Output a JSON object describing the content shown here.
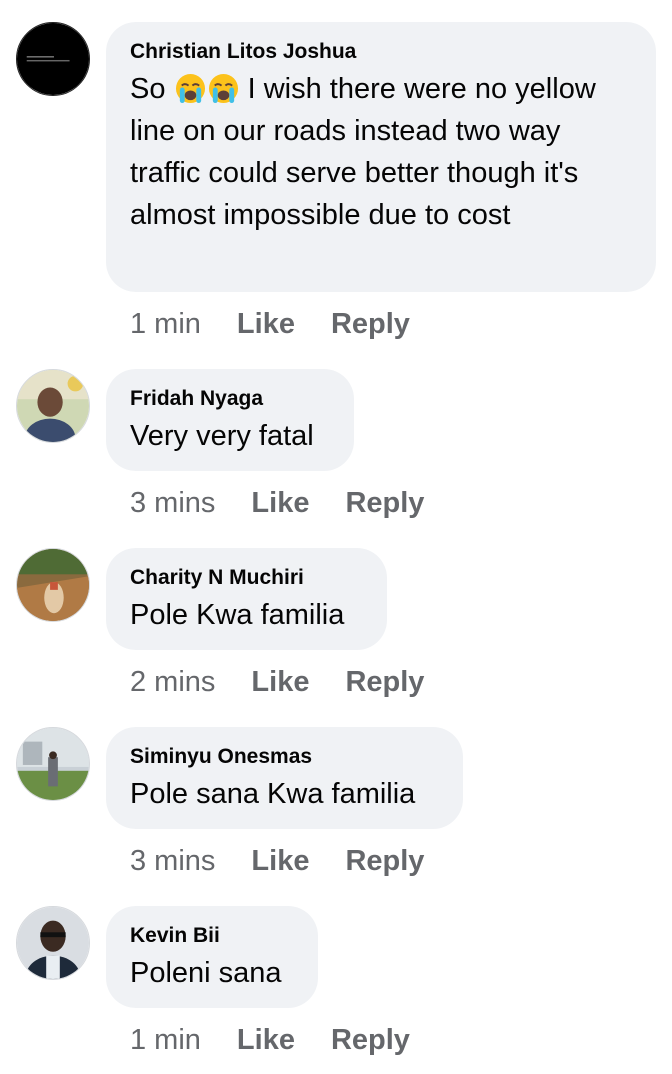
{
  "comments": [
    {
      "author": "Christian Litos Joshua",
      "text_before": "So",
      "emojis": [
        "loudly-crying-face-emoji",
        "loudly-crying-face-emoji"
      ],
      "text_after": " I wish there were no yellow line on our roads instead two way traffic could serve better though it's almost impossible due to cost",
      "time": "1 min",
      "like": "Like",
      "reply": "Reply"
    },
    {
      "author": "Fridah Nyaga",
      "text": "Very very fatal",
      "time": "3 mins",
      "like": "Like",
      "reply": "Reply"
    },
    {
      "author": "Charity N Muchiri",
      "text": "Pole Kwa familia",
      "time": "2 mins",
      "like": "Like",
      "reply": "Reply"
    },
    {
      "author": "Siminyu Onesmas",
      "text": "Pole sana Kwa familia",
      "time": "3 mins",
      "like": "Like",
      "reply": "Reply"
    },
    {
      "author": "Kevin Bii",
      "text": "Poleni sana",
      "time": "1 min",
      "like": "Like",
      "reply": "Reply"
    }
  ],
  "colors": {
    "bubble_bg": "#f0f2f5",
    "text": "#050505",
    "meta": "#65676b"
  }
}
